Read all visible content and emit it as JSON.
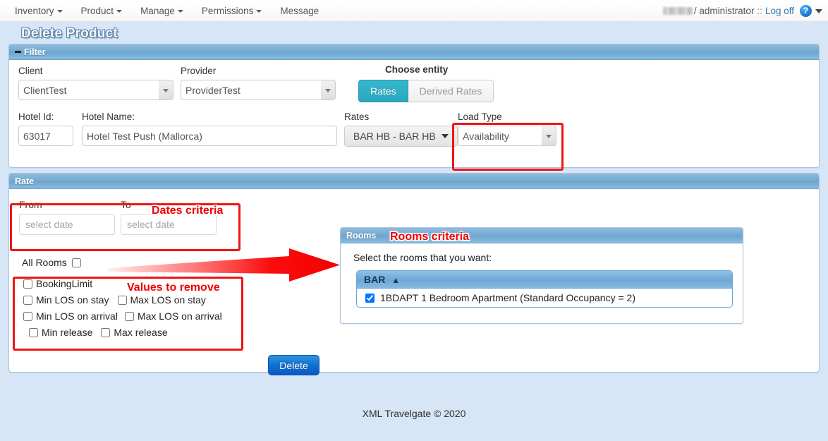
{
  "navbar": {
    "items": [
      {
        "label": "Inventory",
        "caret": true
      },
      {
        "label": "Product",
        "caret": true
      },
      {
        "label": "Manage",
        "caret": true
      },
      {
        "label": "Permissions",
        "caret": true
      },
      {
        "label": "Message",
        "caret": false
      }
    ],
    "user_separator": "/",
    "user": "administrator",
    "double_colon": "::",
    "logoff": "Log off",
    "help_glyph": "?"
  },
  "page": {
    "title": "Delete Product"
  },
  "filter": {
    "header": "Filter",
    "client_label": "Client",
    "client_value": "ClientTest",
    "provider_label": "Provider",
    "provider_value": "ProviderTest",
    "choose_entity_label": "Choose entity",
    "entity_tabs": [
      {
        "label": "Rates",
        "active": true
      },
      {
        "label": "Derived Rates",
        "active": false
      }
    ],
    "hotel_id_label": "Hotel Id:",
    "hotel_id_value": "63017",
    "hotel_name_label": "Hotel Name:",
    "hotel_name_value": "Hotel Test Push (Mallorca)",
    "rates_label": "Rates",
    "rates_value": "BAR HB - BAR HB",
    "load_type_label": "Load Type",
    "load_type_value": "Availability"
  },
  "rate": {
    "header": "Rate",
    "from_label": "From",
    "to_label": "To",
    "date_placeholder": "select date",
    "all_rooms_label": "All Rooms",
    "values": [
      [
        {
          "label": "BookingLimit",
          "checked": false
        }
      ],
      [
        {
          "label": "Min LOS on stay",
          "checked": false
        },
        {
          "label": "Max LOS on stay",
          "checked": false
        }
      ],
      [
        {
          "label": "Min LOS on arrival",
          "checked": false
        },
        {
          "label": "Max LOS on arrival",
          "checked": false
        }
      ],
      [
        {
          "label": "Min release",
          "checked": false
        },
        {
          "label": "Max release",
          "checked": false
        }
      ]
    ],
    "delete_button": "Delete"
  },
  "rooms": {
    "header": "Rooms",
    "instruction": "Select the rooms that you want:",
    "table_header": "BAR",
    "sort_glyph": "▲",
    "rows": [
      {
        "label": "1BDAPT 1 Bedroom Apartment (Standard Occupancy = 2)",
        "checked": true
      }
    ]
  },
  "annotations": {
    "dates_criteria": "Dates criteria",
    "rooms_criteria": "Rooms criteria",
    "values_to_remove": "Values to remove",
    "highlight_color": "#f01414",
    "text_color": "#f00000"
  },
  "footer": {
    "text": "XML Travelgate © 2020"
  }
}
